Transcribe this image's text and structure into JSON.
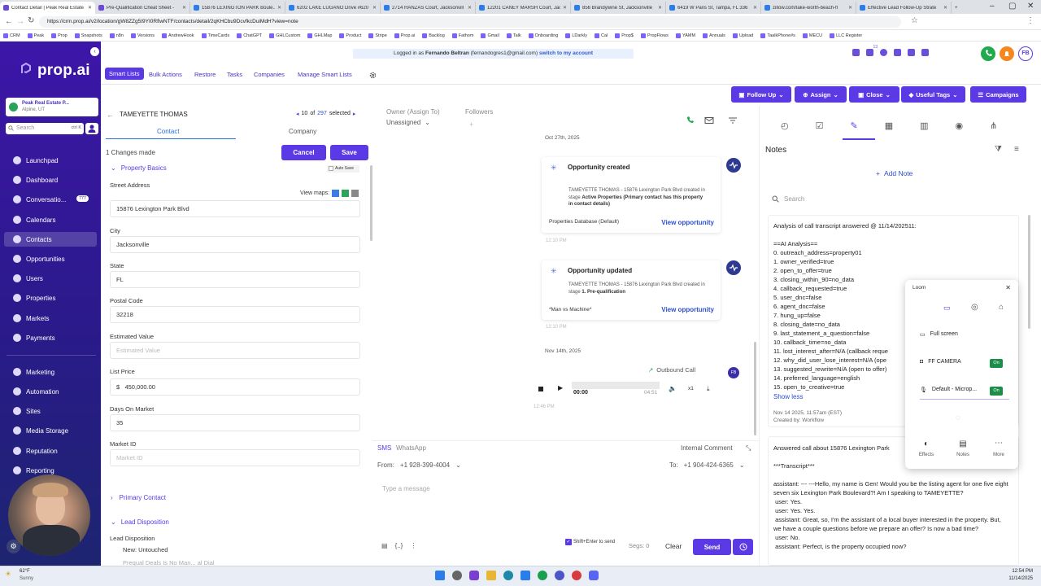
{
  "browser": {
    "tabs": [
      {
        "title": "Contact Detail | Peak Real Estate",
        "active": true
      },
      {
        "title": "Pre-Qualification Cheat Sheet -"
      },
      {
        "title": "15876 LEXINGTON PARK Boule..."
      },
      {
        "title": "6202 LAKE LUGANO Drive #620"
      },
      {
        "title": "2714 HANZAS Court, Jacksonvill"
      },
      {
        "title": "12201 CANEY MARSH Court, Jac"
      },
      {
        "title": "856 Brandywine St, Jacksonville"
      },
      {
        "title": "6419 W Paris St, Tampa, FL 336"
      },
      {
        "title": "zillow.com/lake-worth-beach-fl"
      },
      {
        "title": "Effective Lead Follow-Up Strate"
      }
    ],
    "new_tab": "+",
    "url": "https://crm.prop.ai/v2/location/gW8ZZg5I9YI0RfiwNTF/contacts/detail/2qKHCbu9DcvfkcDuiMdH?view=note",
    "bookmarks": [
      "CRM",
      "Peak",
      "Prop",
      "Snapshots",
      "n8n",
      "Versions",
      "AndrewHook",
      "TimeCards",
      "ChatGPT",
      "GHLCustom",
      "GHLMap",
      "Product",
      "Stripe",
      "Prop.ai",
      "Backlog",
      "Fathom",
      "Gmail",
      "Talk",
      "Onboarding",
      "LDarkly",
      "Cal",
      "Prop$",
      "PropFlows",
      "YAMM",
      "Annuals",
      "Upload",
      "TaalkPhone#s",
      "MECU",
      "LLC Register"
    ]
  },
  "sidebar": {
    "logo": "prop.ai",
    "location_name": "Peak Real Estate P...",
    "location_sub": "Alpine, UT",
    "search_placeholder": "Search",
    "search_shortcut": "ctrl K",
    "items": [
      {
        "label": "Launchpad",
        "icon": "rocket-icon"
      },
      {
        "label": "Dashboard",
        "icon": "dashboard-icon"
      },
      {
        "label": "Conversatio...",
        "icon": "chat-icon",
        "badge": "777"
      },
      {
        "label": "Calendars",
        "icon": "calendar-icon"
      },
      {
        "label": "Contacts",
        "icon": "contacts-icon",
        "active": true
      },
      {
        "label": "Opportunities",
        "icon": "opportunities-icon"
      },
      {
        "label": "Users",
        "icon": "users-icon"
      },
      {
        "label": "Properties",
        "icon": "properties-icon"
      },
      {
        "label": "Markets",
        "icon": "markets-icon"
      },
      {
        "label": "Payments",
        "icon": "payments-icon"
      },
      {
        "label": "Marketing",
        "icon": "marketing-icon"
      },
      {
        "label": "Automation",
        "icon": "automation-icon"
      },
      {
        "label": "Sites",
        "icon": "sites-icon"
      },
      {
        "label": "Media Storage",
        "icon": "media-icon"
      },
      {
        "label": "Reputation",
        "icon": "reputation-icon"
      },
      {
        "label": "Reporting",
        "icon": "reporting-icon"
      }
    ]
  },
  "header": {
    "logged_in_prefix": "Logged in as",
    "user_name": "Fernando Beltran",
    "user_email": "(fernandogres1@gmail.com)",
    "switch_link": "switch to my account",
    "avatar_initials": "FB",
    "notification_count": "13"
  },
  "subnav": {
    "items": [
      "Smart Lists",
      "Bulk Actions",
      "Restore",
      "Tasks",
      "Companies",
      "Manage Smart Lists"
    ],
    "active": "Smart Lists"
  },
  "actions": [
    "Follow Up",
    "Assign",
    "Close",
    "Useful Tags",
    "Campaigns"
  ],
  "contact": {
    "name": "TAMEYETTE THOMAS",
    "index": "10",
    "of_label": "of",
    "total": "297",
    "selected_label": "selected",
    "tab_contact": "Contact",
    "tab_company": "Company",
    "changes": "1 Changes made",
    "cancel": "Cancel",
    "save": "Save",
    "section_property": "Property Basics",
    "auto_save": "Auto Save",
    "view_maps": "View maps:",
    "fields": {
      "street_label": "Street Address",
      "street": "15876 Lexington Park Blvd",
      "city_label": "City",
      "city": "Jacksonville",
      "state_label": "State",
      "state": "FL",
      "postal_label": "Postal Code",
      "postal": "32218",
      "est_label": "Estimated Value",
      "est_placeholder": "Estimated Value",
      "list_label": "List Price",
      "currency": "$",
      "list": "450,000.00",
      "dom_label": "Days On Market",
      "dom": "35",
      "market_label": "Market ID",
      "market_placeholder": "Market ID"
    },
    "section_primary": "Primary Contact",
    "section_lead": "Lead Disposition",
    "lead_label": "Lead Disposition",
    "lead_value": "New: Untouched",
    "lead_cut": "Prequal Deals Is No Man... al Dial"
  },
  "owner": {
    "owner_label": "Owner (Assign To)",
    "owner_value": "Unassigned",
    "followers_label": "Followers"
  },
  "timeline": {
    "date1": "Oct 27th, 2025",
    "card1": {
      "title": "Opportunity created",
      "body_pre": "TAMEYETTE THOMAS - 15876 Lexington Park Blvd created in stage ",
      "body_bold": "Active Properties (Primary contact has this property in contact details)",
      "source": "Properties Database (Default)",
      "link": "View opportunity"
    },
    "time1": "12:10 PM",
    "card2": {
      "title": "Opportunity updated",
      "body_pre": "TAMEYETTE THOMAS - 15876 Lexington Park Blvd created in stage ",
      "body_bold": "1. Pre-qualification",
      "source": "*Man vs Machine*",
      "link": "View opportunity"
    },
    "time2": "12:10 PM",
    "date2": "Nov 14th, 2025",
    "call_label": "Outbound Call",
    "call_avatar": "FB",
    "audio_current": "00:00",
    "audio_total": "04:51",
    "audio_speed": "x1",
    "time3": "12:46 PM"
  },
  "composer": {
    "tab_sms": "SMS",
    "tab_whatsapp": "WhatsApp",
    "internal_comment": "Internal Comment",
    "from_label": "From:",
    "from_number": "+1 928-399-4004",
    "to_label": "To:",
    "to_number": "+1 904-424-6365",
    "placeholder": "Type a message",
    "shift_enter": "Shift+Enter to send",
    "segs": "Segs: 0",
    "clear": "Clear",
    "send": "Send"
  },
  "notes": {
    "title": "Notes",
    "add_note": "Add Note",
    "search_placeholder": "Search",
    "note1_text": "Analysis of call transcript answered @ 11/14/202511:\n\n==AI Analysis==\n0. outreach_address=property01\n1. owner_verified=true\n2. open_to_offer=true\n3. closing_within_90=no_data\n4. callback_requested=true\n5. user_dnc=false\n6. agent_dnc=false\n7. hung_up=false\n8. closing_date=no_data\n9. last_statement_a_question=false\n10. callback_time=no_data\n11. lost_interest_after=N/A (callback reque\n12. why_did_user_lose_interest=N/A (ope\n13. suggested_rewrite=N/A (open to offer)\n14. preferred_language=english\n15. open_to_creative=true",
    "show_less": "Show less",
    "note1_meta": "Nov 14 2025, 11:57am (EST)",
    "note1_created": "Created by: Workflow",
    "note2_text": "Answered call about 15876 Lexington Park\n\n***Transcript***\n\nassistant: --- ---Hello, my name is Gen! Would you be the listing agent for one five eight seven six Lexington Park Boulevard?! Am I speaking to TAMEYETTE?\n user: Yes.\n user: Yes. Yes.\n assistant: Great, so, I'm the assistant of a local buyer interested in the property. But, we have a couple questions before we prepare an offer? Is now a bad time?\n user: No.\n assistant: Perfect, is the property occupied now?"
  },
  "loom": {
    "title": "Loom",
    "full_screen": "Full screen",
    "camera": "FF CAMERA",
    "camera_state": "On",
    "mic": "Default - Microp...",
    "mic_state": "On",
    "effects": "Effects",
    "notes": "Notes",
    "more": "More"
  },
  "taskbar": {
    "weather_temp": "62°F",
    "weather_desc": "Sunny",
    "time": "12:54 PM",
    "date": "11/14/2025"
  },
  "colors": {
    "brand": "#5b3ae6",
    "sidebar_top": "#3d16a8",
    "link": "#2d4ed1",
    "on_green": "#1b8f4a"
  }
}
